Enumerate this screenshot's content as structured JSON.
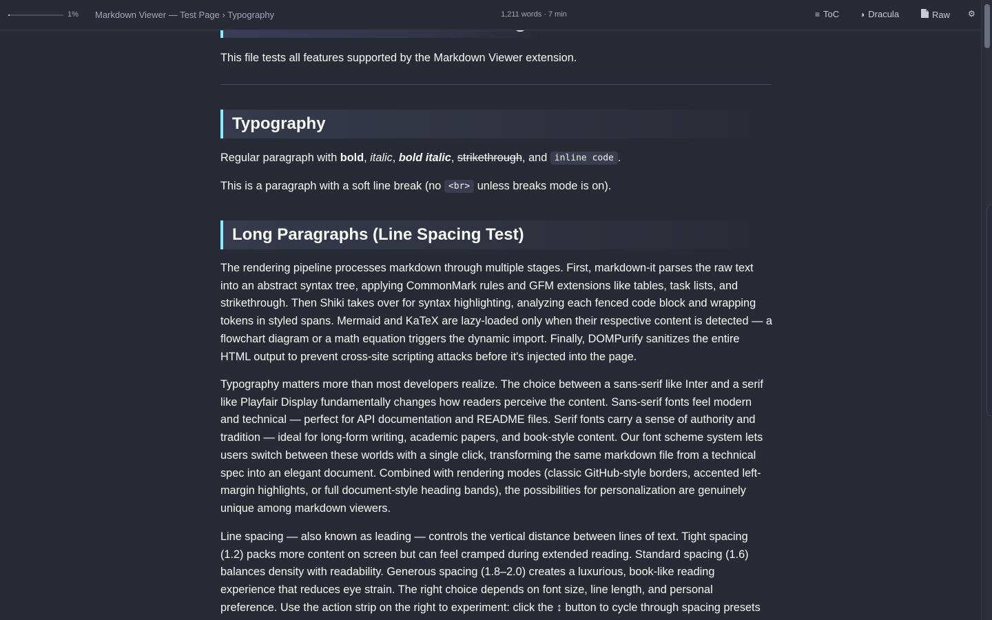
{
  "topbar": {
    "progress_percent": 1,
    "progress_label": "1%",
    "breadcrumb": "Markdown Viewer — Test Page › Typography",
    "stats": "1,211 words · 7 min",
    "toc_icon": "≡",
    "toc_label": "ToC",
    "theme_icon": "◑",
    "theme_label": "Dracula",
    "raw_icon": "file-icon",
    "raw_label": "Raw",
    "settings_icon": "⚙"
  },
  "colors": {
    "background": "#282a36",
    "accent": "#8be9fd",
    "text": "#f8f8f2",
    "muted": "#a4a7b8"
  },
  "doc": {
    "intro": "This file tests all features supported by the Markdown Viewer extension.",
    "typography": {
      "heading": "Typography",
      "p1": {
        "prefix": "Regular paragraph with ",
        "bold": "bold",
        "sep1": ", ",
        "italic": "italic",
        "sep2": ", ",
        "bold_italic": "bold italic",
        "sep3": ", ",
        "strike": "strikethrough",
        "sep4": ", and ",
        "code": "inline code",
        "end": "."
      },
      "p2": {
        "prefix": "This is a paragraph with a soft line break (no ",
        "code": "<br>",
        "suffix": " unless breaks mode is on)."
      }
    },
    "long": {
      "heading": "Long Paragraphs (Line Spacing Test)",
      "p1": [
        "The rendering pipeline processes markdown through multiple stages. First, markdown-it parses the raw text",
        "into an abstract syntax tree, applying CommonMark rules and GFM extensions like tables, task lists, and",
        "strikethrough. Then Shiki takes over for syntax highlighting, analyzing each fenced code block and wrapping",
        "tokens in styled spans. Mermaid and KaTeX are lazy-loaded only when their respective content is detected — a",
        "flowchart diagram or a math equation triggers the dynamic import. Finally, DOMPurify sanitizes the entire",
        "HTML output to prevent cross-site scripting attacks before it's injected into the page."
      ],
      "p2": [
        "Typography matters more than most developers realize. The choice between a sans-serif like Inter and a serif",
        "like Playfair Display fundamentally changes how readers perceive the content. Sans-serif fonts feel modern",
        "and technical — perfect for API documentation and README files. Serif fonts carry a sense of authority and",
        "tradition — ideal for long-form writing, academic papers, and book-style content. Our font scheme system lets",
        "users switch between these worlds with a single click, transforming the same markdown file from a technical",
        "spec into an elegant document. Combined with rendering modes (classic GitHub-style borders, accented left-",
        "margin highlights, or full document-style heading bands), the possibilities for personalization are genuinely",
        "unique among markdown viewers."
      ],
      "p3": [
        "Line spacing — also known as leading — controls the vertical distance between lines of text. Tight spacing",
        "(1.2) packs more content on screen but can feel cramped during extended reading. Standard spacing (1.6)",
        "balances density with readability. Generous spacing (1.8–2.0) creates a luxurious, book-like reading",
        "experience that reduces eye strain. The right choice depends on font size, line length, and personal",
        "preference. Use the action strip on the right to experiment: click the ↕ button to cycle through spacing presets"
      ]
    }
  }
}
